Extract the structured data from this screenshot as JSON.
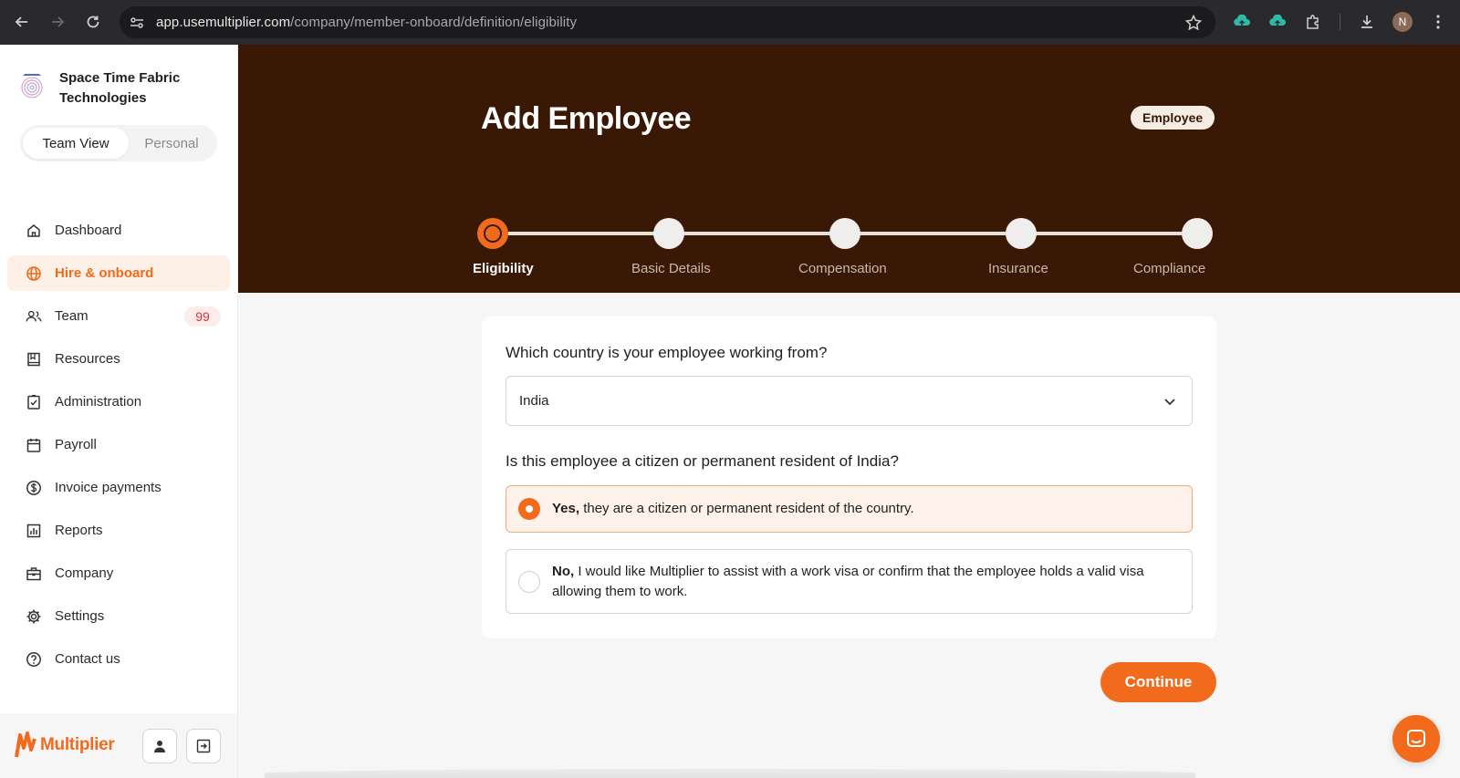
{
  "browser": {
    "url_host": "app.usemultiplier.com",
    "url_path": "/company/member-onboard/definition/eligibility",
    "profile_initial": "N"
  },
  "sidebar": {
    "org_name": "Space Time Fabric Technologies",
    "view_toggle": {
      "team": "Team View",
      "personal": "Personal"
    },
    "items": [
      {
        "label": "Dashboard",
        "icon": "home-icon"
      },
      {
        "label": "Hire & onboard",
        "icon": "globe-icon",
        "active": true
      },
      {
        "label": "Team",
        "icon": "people-icon",
        "badge": "99"
      },
      {
        "label": "Resources",
        "icon": "book-icon"
      },
      {
        "label": "Administration",
        "icon": "clipboard-check-icon"
      },
      {
        "label": "Payroll",
        "icon": "calendar-icon"
      },
      {
        "label": "Invoice payments",
        "icon": "dollar-circle-icon"
      },
      {
        "label": "Reports",
        "icon": "bar-chart-icon"
      },
      {
        "label": "Company",
        "icon": "building-icon"
      },
      {
        "label": "Settings",
        "icon": "gear-icon"
      },
      {
        "label": "Contact us",
        "icon": "help-circle-icon"
      }
    ],
    "brand": "Multiplier"
  },
  "header": {
    "title": "Add Employee",
    "role_badge": "Employee",
    "steps": [
      "Eligibility",
      "Basic Details",
      "Compensation",
      "Insurance",
      "Compliance"
    ],
    "current_step": 0
  },
  "form": {
    "country_question": "Which country is your employee working from?",
    "country_value": "India",
    "citizen_question": "Is this employee a citizen or permanent resident of India?",
    "option_yes_bold": "Yes,",
    "option_yes_text": " they are a citizen or permanent resident of the country.",
    "option_no_bold": "No,",
    "option_no_text": " I would like Multiplier to assist with a work visa or confirm that the employee holds a valid visa allowing them to work.",
    "selected": "yes"
  },
  "actions": {
    "continue_label": "Continue"
  },
  "colors": {
    "accent": "#f26b1d",
    "hero_bg": "#3a1806",
    "badge_red": "#d93434"
  }
}
